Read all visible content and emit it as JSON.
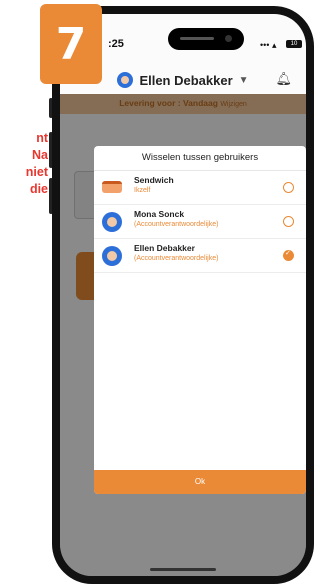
{
  "step_badge": "7",
  "instruction_fragments": [
    "nt",
    "Na",
    "niet",
    "die"
  ],
  "status_bar": {
    "time": ":25",
    "signal": "••• ▴",
    "battery": "10"
  },
  "header": {
    "user_name": "Ellen Debakker",
    "caret": "▼",
    "bell_icon": "bell-icon"
  },
  "delivery_bar": {
    "label": "Levering voor : Vandaag",
    "action": "Wijzigen"
  },
  "modal": {
    "title": "Wisselen tussen gebruikers",
    "users": [
      {
        "name": "Sendwich",
        "role": "Ikzelf",
        "avatar": "sandwich-icon",
        "selected": false
      },
      {
        "name": "Mona Sonck",
        "role": "(Accountverantwoordelijke)",
        "avatar": "avatar-icon",
        "selected": false
      },
      {
        "name": "Ellen Debakker",
        "role": "(Accountverantwoordelijke)",
        "avatar": "avatar-icon",
        "selected": true
      }
    ],
    "ok_label": "Ok"
  },
  "colors": {
    "accent": "#ea8a36",
    "instruction_red": "#e8372f",
    "avatar_blue": "#2d6fd9"
  }
}
